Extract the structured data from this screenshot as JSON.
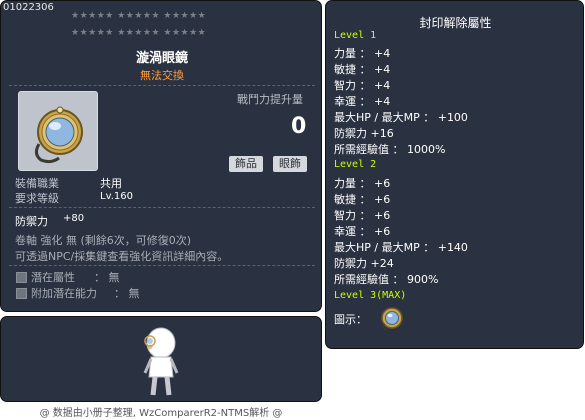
{
  "item": {
    "code": "01022306",
    "stars_row1": "★★★★★  ★★★★★  ★★★★★",
    "stars_row2": "★★★★★  ★★★★★  ★★★★★",
    "name": "漩渦眼鏡",
    "untradable": "無法交換",
    "icon": "gold-mirror-glasses-icon",
    "power_label": "戰鬥力提升量",
    "power_value": "0",
    "tags": [
      "飾品",
      "眼飾"
    ],
    "job_label": "裝備職業",
    "job_value": "共用",
    "level_label": "要求等級",
    "level_value": "Lv.160",
    "defense_label": "防禦力",
    "defense_value": "+80",
    "upgrade_text": "卷軸 強化 無 (剩餘6次，可修復0次)",
    "npc_text": "可透過NPC/採集鍵查看強化資訊詳細內容。",
    "potential_label": "潛在屬性",
    "potential_value": "： 無",
    "bonus_potential_label": "附加潛在能力",
    "bonus_potential_value": "： 無"
  },
  "seal": {
    "title": "封印解除屬性",
    "levels": [
      {
        "label": "Level 1",
        "stats": [
          "力量 ： +4",
          "敏捷 ： +4",
          "智力 ： +4",
          "幸運 ： +4",
          "最大HP / 最大MP ： +100",
          "防禦力 +16",
          "所需經驗值 ： 1000%"
        ]
      },
      {
        "label": "Level 2",
        "stats": [
          "力量 ： +6",
          "敏捷 ： +6",
          "智力 ： +6",
          "幸運 ： +6",
          "最大HP / 最大MP ： +140",
          "防禦力 +24",
          "所需經驗值 ： 900%"
        ]
      }
    ],
    "level3_label": "Level 3(MAX)",
    "icon_label": "圖示："
  },
  "footer": "@ 数据由小册子整理, WzComparerR2-NTMS解析 @",
  "colors": {
    "panel": "#2a3140",
    "level_green": "#ccff00",
    "untradable_orange": "#ff9e3d"
  }
}
